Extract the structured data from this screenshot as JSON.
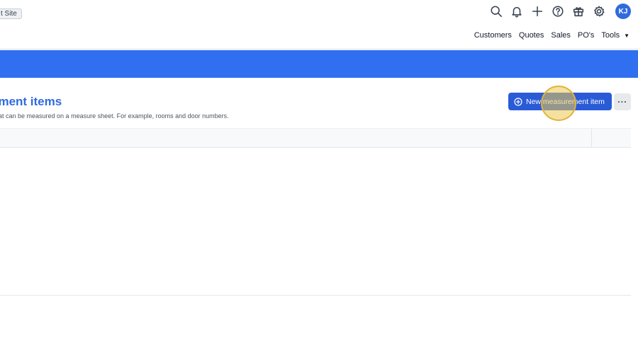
{
  "header": {
    "site_badge": "t Site",
    "icons": [
      "search-icon",
      "bell-icon",
      "plus-icon",
      "help-icon",
      "gift-icon",
      "gear-icon"
    ],
    "avatar_initials": "KJ",
    "nav": [
      "Customers",
      "Quotes",
      "Sales",
      "PO's",
      "Tools"
    ]
  },
  "page": {
    "title": "ement items",
    "description": "at can be measured on a measure sheet. For example, rooms and door numbers.",
    "new_button_label": "New measurement item",
    "more_button_label": "···"
  },
  "colors": {
    "accent": "#2f6ff0",
    "title": "#2f6bdc",
    "button": "#2a5bd7",
    "highlight": "#e3b23c"
  }
}
